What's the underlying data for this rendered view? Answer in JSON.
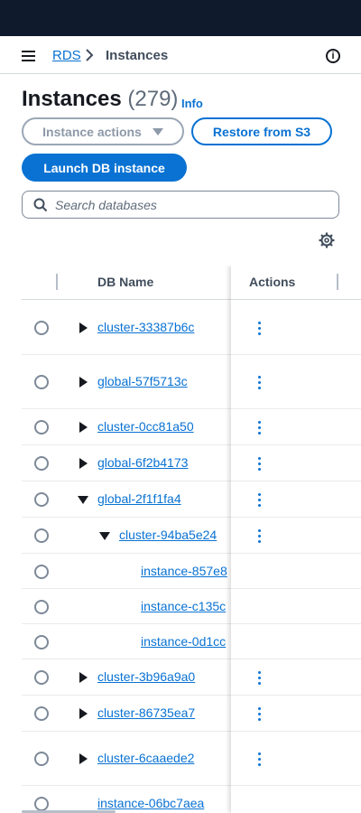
{
  "breadcrumb": {
    "root": "RDS",
    "current": "Instances"
  },
  "header": {
    "title": "Instances",
    "count": "(279)",
    "info": "Info"
  },
  "buttons": {
    "instance_actions": "Instance actions",
    "restore": "Restore from S3",
    "launch": "Launch DB instance"
  },
  "search": {
    "placeholder": "Search databases"
  },
  "table": {
    "columns": {
      "db_name": "DB Name",
      "actions": "Actions"
    },
    "rows": [
      {
        "name": "cluster-33387b6c"
      },
      {
        "name": "global-57f5713c"
      },
      {
        "name": "cluster-0cc81a50"
      },
      {
        "name": "global-6f2b4173"
      },
      {
        "name": "global-2f1f1fa4"
      },
      {
        "name": "cluster-94ba5e24"
      },
      {
        "name": "instance-857e8"
      },
      {
        "name": "instance-c135c"
      },
      {
        "name": "instance-0d1cc"
      },
      {
        "name": "cluster-3b96a9a0"
      },
      {
        "name": "cluster-86735ea7"
      },
      {
        "name": "cluster-6caaede2"
      },
      {
        "name": "instance-06bc7aea"
      }
    ]
  },
  "colors": {
    "topbar": "#0f1b2d",
    "link": "#0972d3",
    "accent": "#0972d3"
  },
  "icons": [
    "hamburger-icon",
    "chevron-right-icon",
    "info-icon",
    "caret-down-icon",
    "search-icon",
    "gear-icon",
    "expand-icon",
    "collapse-icon",
    "more-actions-icon"
  ]
}
